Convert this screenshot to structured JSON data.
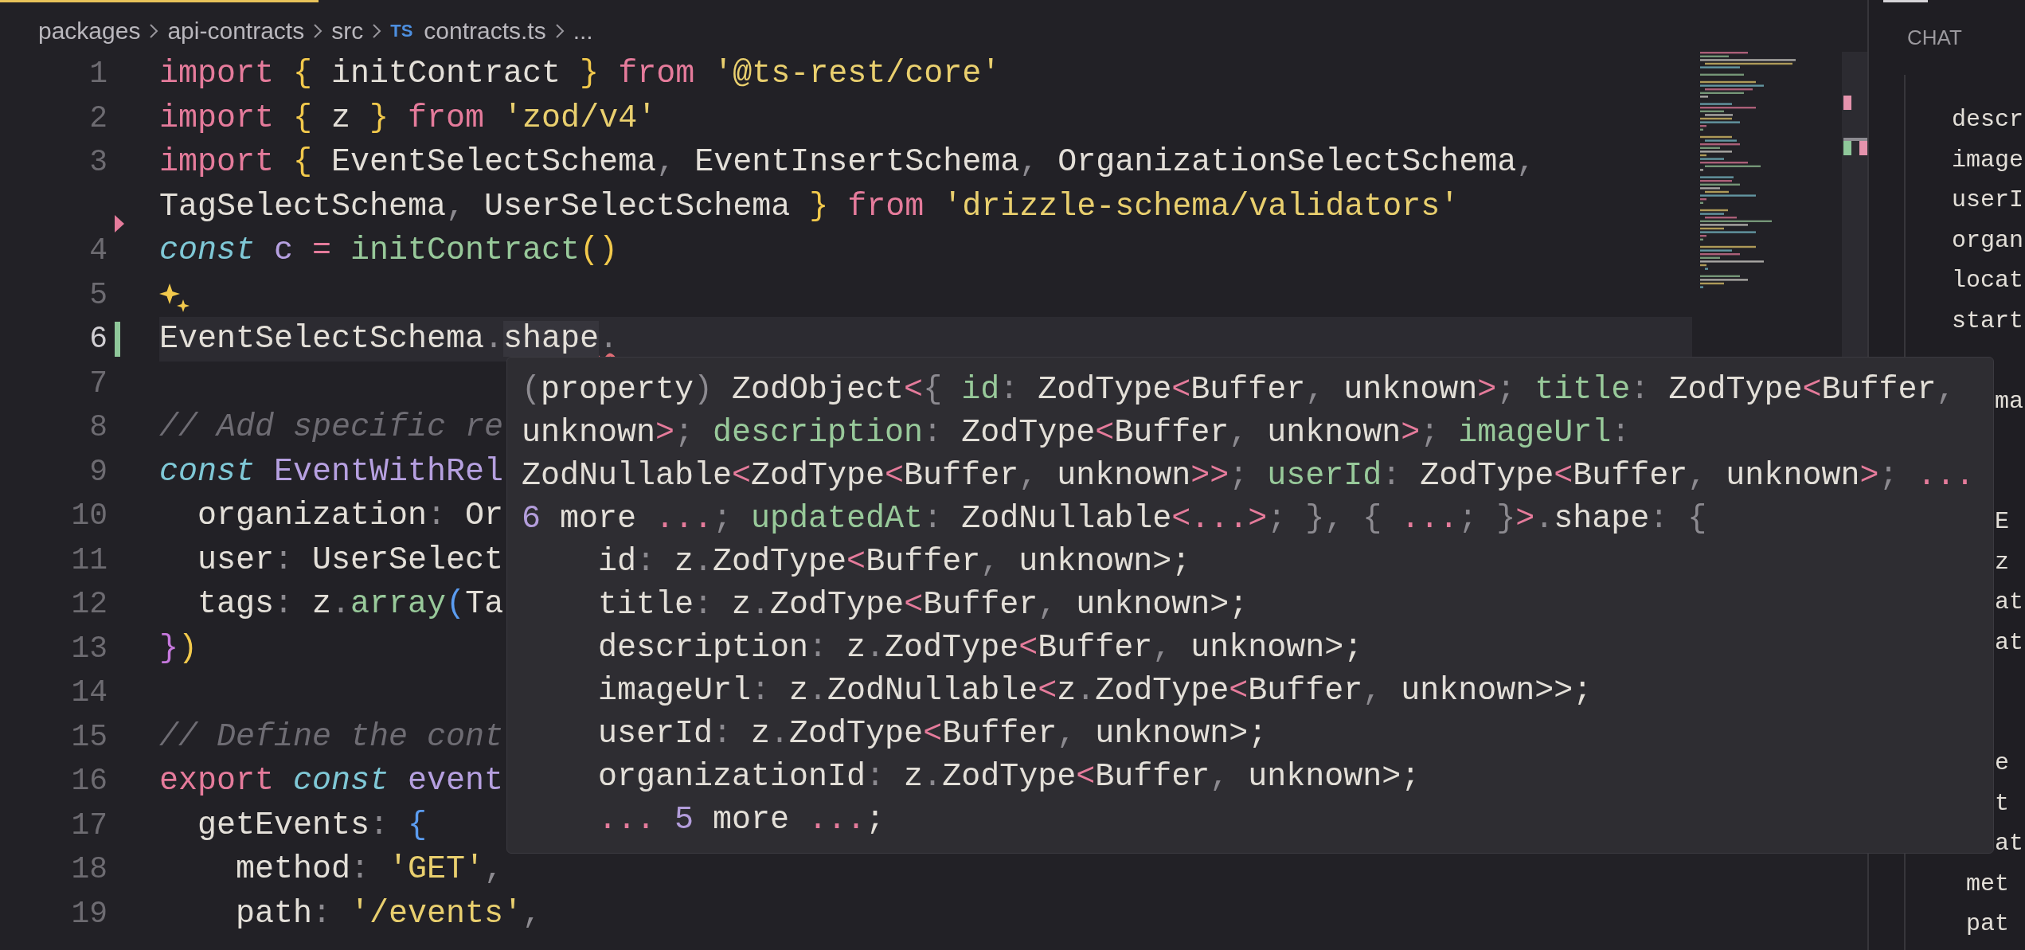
{
  "breadcrumb": [
    {
      "text": "packages"
    },
    {
      "text": "api-contracts"
    },
    {
      "text": "src"
    },
    {
      "text": "contracts.ts",
      "badge": "TS"
    },
    {
      "text": "..."
    }
  ],
  "editor": {
    "lines": [
      {
        "number": "1",
        "kind": "code",
        "current": false,
        "tokens": [
          {
            "text": "import ",
            "kind": "keyword"
          },
          {
            "text": "{",
            "kind": "bracket"
          },
          {
            "text": " initContract ",
            "kind": "plain"
          },
          {
            "text": "} ",
            "kind": "bracket"
          },
          {
            "text": "from ",
            "kind": "keyword"
          },
          {
            "text": "'@ts-rest/core'",
            "kind": "string"
          }
        ]
      },
      {
        "number": "2",
        "kind": "code",
        "current": false,
        "tokens": [
          {
            "text": "import ",
            "kind": "keyword"
          },
          {
            "text": "{",
            "kind": "bracket"
          },
          {
            "text": " z ",
            "kind": "plain"
          },
          {
            "text": "} ",
            "kind": "bracket"
          },
          {
            "text": "from ",
            "kind": "keyword"
          },
          {
            "text": "'zod/v4'",
            "kind": "string"
          }
        ]
      },
      {
        "number": "3",
        "kind": "code",
        "current": false,
        "tokens": [
          {
            "text": "import ",
            "kind": "keyword"
          },
          {
            "text": "{",
            "kind": "bracket"
          },
          {
            "text": " EventSelectSchema",
            "kind": "plain"
          },
          {
            "text": ",",
            "kind": "punct"
          },
          {
            "text": " EventInsertSchema",
            "kind": "plain"
          },
          {
            "text": ",",
            "kind": "punct"
          },
          {
            "text": " OrganizationSelectSchema",
            "kind": "plain"
          },
          {
            "text": ",",
            "kind": "punct"
          }
        ]
      },
      {
        "kind": "deleted",
        "current": false,
        "tokens": [
          {
            "text": "TagSelectSchema",
            "kind": "plain"
          },
          {
            "text": ",",
            "kind": "punct"
          },
          {
            "text": " UserSelectSchema ",
            "kind": "plain"
          },
          {
            "text": "} ",
            "kind": "bracket"
          },
          {
            "text": "from ",
            "kind": "keyword"
          },
          {
            "text": "'drizzle-schema/validators'",
            "kind": "string"
          }
        ]
      },
      {
        "number": "4",
        "kind": "code",
        "current": false,
        "tokens": [
          {
            "text": "const ",
            "kind": "storage"
          },
          {
            "text": "c ",
            "kind": "variable"
          },
          {
            "text": "= ",
            "kind": "operator"
          },
          {
            "text": "initContract",
            "kind": "function"
          },
          {
            "text": "()",
            "kind": "bracket"
          }
        ]
      },
      {
        "number": "5",
        "kind": "sparkle",
        "current": false
      },
      {
        "number": "6",
        "kind": "added",
        "current": true,
        "tokens": [
          {
            "text": "EventSelectSchema",
            "kind": "plain"
          },
          {
            "text": ".",
            "kind": "punct"
          },
          {
            "text": "shape",
            "kind": "match"
          },
          {
            "text": ".",
            "kind": "error"
          }
        ]
      },
      {
        "number": "7",
        "kind": "code",
        "current": false
      },
      {
        "number": "8",
        "kind": "code",
        "current": false,
        "tokens": [
          {
            "text": "// Add specific re",
            "kind": "comment"
          }
        ]
      },
      {
        "number": "9",
        "kind": "code",
        "current": false,
        "tokens": [
          {
            "text": "const ",
            "kind": "storage"
          },
          {
            "text": "EventWithRel",
            "kind": "variable"
          }
        ]
      },
      {
        "number": "10",
        "kind": "code",
        "current": false,
        "tokens": [
          {
            "text": "  organization",
            "kind": "plain"
          },
          {
            "text": ":",
            "kind": "punct"
          },
          {
            "text": " Or",
            "kind": "plain"
          }
        ]
      },
      {
        "number": "11",
        "kind": "code",
        "current": false,
        "tokens": [
          {
            "text": "  user",
            "kind": "plain"
          },
          {
            "text": ":",
            "kind": "punct"
          },
          {
            "text": " UserSelect",
            "kind": "plain"
          }
        ]
      },
      {
        "number": "12",
        "kind": "code",
        "current": false,
        "tokens": [
          {
            "text": "  tags",
            "kind": "plain"
          },
          {
            "text": ":",
            "kind": "punct"
          },
          {
            "text": " z",
            "kind": "plain"
          },
          {
            "text": ".",
            "kind": "punct"
          },
          {
            "text": "array",
            "kind": "function"
          },
          {
            "text": "(",
            "kind": "bracket3"
          },
          {
            "text": "Ta",
            "kind": "plain"
          }
        ]
      },
      {
        "number": "13",
        "kind": "code",
        "current": false,
        "tokens": [
          {
            "text": "}",
            "kind": "bracket2"
          },
          {
            "text": ")",
            "kind": "bracket"
          }
        ]
      },
      {
        "number": "14",
        "kind": "code",
        "current": false
      },
      {
        "number": "15",
        "kind": "code",
        "current": false,
        "tokens": [
          {
            "text": "// Define the cont",
            "kind": "comment"
          }
        ]
      },
      {
        "number": "16",
        "kind": "code",
        "current": false,
        "tokens": [
          {
            "text": "export ",
            "kind": "keyword"
          },
          {
            "text": "const ",
            "kind": "storage"
          },
          {
            "text": "event",
            "kind": "variable"
          }
        ]
      },
      {
        "number": "17",
        "kind": "code",
        "current": false,
        "tokens": [
          {
            "text": "  getEvents",
            "kind": "plain"
          },
          {
            "text": ": ",
            "kind": "punct"
          },
          {
            "text": "{",
            "kind": "bracket3"
          }
        ]
      },
      {
        "number": "18",
        "kind": "code",
        "current": false,
        "tokens": [
          {
            "text": "    method",
            "kind": "plain"
          },
          {
            "text": ": ",
            "kind": "punct"
          },
          {
            "text": "'GET'",
            "kind": "string"
          },
          {
            "text": ",",
            "kind": "punct"
          }
        ]
      },
      {
        "number": "19",
        "kind": "code",
        "current": false,
        "tokens": [
          {
            "text": "    path",
            "kind": "plain"
          },
          {
            "text": ": ",
            "kind": "punct"
          },
          {
            "text": "'/events'",
            "kind": "string"
          },
          {
            "text": ",",
            "kind": "punct"
          }
        ]
      }
    ]
  },
  "hover_tooltip": {
    "lines": [
      [
        {
          "text": "(",
          "kind": "punct"
        },
        {
          "text": "property",
          "kind": "plain"
        },
        {
          "text": ")",
          "kind": "punct"
        },
        {
          "text": " ZodObject",
          "kind": "plain"
        },
        {
          "text": "<",
          "kind": "operator"
        },
        {
          "text": "{ ",
          "kind": "punct"
        },
        {
          "text": "id",
          "kind": "property"
        },
        {
          "text": ":",
          "kind": "punct"
        },
        {
          "text": " ZodType",
          "kind": "plain"
        },
        {
          "text": "<",
          "kind": "operator"
        },
        {
          "text": "Buffer",
          "kind": "plain"
        },
        {
          "text": ",",
          "kind": "punct"
        },
        {
          "text": " unknown",
          "kind": "plain"
        },
        {
          "text": ">",
          "kind": "operator"
        },
        {
          "text": "; ",
          "kind": "punct"
        },
        {
          "text": "title",
          "kind": "property"
        },
        {
          "text": ":",
          "kind": "punct"
        },
        {
          "text": " ZodType",
          "kind": "plain"
        },
        {
          "text": "<",
          "kind": "operator"
        },
        {
          "text": "Buffer",
          "kind": "plain"
        },
        {
          "text": ",",
          "kind": "punct"
        }
      ],
      [
        {
          "text": "unknown",
          "kind": "plain"
        },
        {
          "text": ">",
          "kind": "operator"
        },
        {
          "text": "; ",
          "kind": "punct"
        },
        {
          "text": "description",
          "kind": "property"
        },
        {
          "text": ":",
          "kind": "punct"
        },
        {
          "text": " ZodType",
          "kind": "plain"
        },
        {
          "text": "<",
          "kind": "operator"
        },
        {
          "text": "Buffer",
          "kind": "plain"
        },
        {
          "text": ",",
          "kind": "punct"
        },
        {
          "text": " unknown",
          "kind": "plain"
        },
        {
          "text": ">",
          "kind": "operator"
        },
        {
          "text": "; ",
          "kind": "punct"
        },
        {
          "text": "imageUrl",
          "kind": "property"
        },
        {
          "text": ":",
          "kind": "punct"
        }
      ],
      [
        {
          "text": "ZodNullable",
          "kind": "plain"
        },
        {
          "text": "<",
          "kind": "operator"
        },
        {
          "text": "ZodType",
          "kind": "plain"
        },
        {
          "text": "<",
          "kind": "operator"
        },
        {
          "text": "Buffer",
          "kind": "plain"
        },
        {
          "text": ",",
          "kind": "punct"
        },
        {
          "text": " unknown",
          "kind": "plain"
        },
        {
          "text": ">>",
          "kind": "operator"
        },
        {
          "text": "; ",
          "kind": "punct"
        },
        {
          "text": "userId",
          "kind": "property"
        },
        {
          "text": ":",
          "kind": "punct"
        },
        {
          "text": " ZodType",
          "kind": "plain"
        },
        {
          "text": "<",
          "kind": "operator"
        },
        {
          "text": "Buffer",
          "kind": "plain"
        },
        {
          "text": ",",
          "kind": "punct"
        },
        {
          "text": " unknown",
          "kind": "plain"
        },
        {
          "text": ">",
          "kind": "operator"
        },
        {
          "text": "; ",
          "kind": "punct"
        },
        {
          "text": "...",
          "kind": "operator"
        }
      ],
      [
        {
          "text": "6",
          "kind": "number"
        },
        {
          "text": " more ",
          "kind": "plain"
        },
        {
          "text": "...",
          "kind": "operator"
        },
        {
          "text": "; ",
          "kind": "punct"
        },
        {
          "text": "updatedAt",
          "kind": "property"
        },
        {
          "text": ":",
          "kind": "punct"
        },
        {
          "text": " ZodNullable",
          "kind": "plain"
        },
        {
          "text": "<...>",
          "kind": "operator"
        },
        {
          "text": "; }, { ",
          "kind": "punct"
        },
        {
          "text": "...",
          "kind": "operator"
        },
        {
          "text": "; }",
          "kind": "punct"
        },
        {
          "text": ">",
          "kind": "operator"
        },
        {
          "text": ".",
          "kind": "punct"
        },
        {
          "text": "shape",
          "kind": "plain"
        },
        {
          "text": ":",
          "kind": "punct"
        },
        {
          "text": " {",
          "kind": "punct"
        }
      ],
      [
        {
          "text": "    id",
          "kind": "plain"
        },
        {
          "text": ":",
          "kind": "punct"
        },
        {
          "text": " z",
          "kind": "plain"
        },
        {
          "text": ".",
          "kind": "punct"
        },
        {
          "text": "ZodType",
          "kind": "plain"
        },
        {
          "text": "<",
          "kind": "operator"
        },
        {
          "text": "Buffer",
          "kind": "plain"
        },
        {
          "text": ",",
          "kind": "punct"
        },
        {
          "text": " unknown>;",
          "kind": "plain"
        }
      ],
      [
        {
          "text": "    title",
          "kind": "plain"
        },
        {
          "text": ":",
          "kind": "punct"
        },
        {
          "text": " z",
          "kind": "plain"
        },
        {
          "text": ".",
          "kind": "punct"
        },
        {
          "text": "ZodType",
          "kind": "plain"
        },
        {
          "text": "<",
          "kind": "operator"
        },
        {
          "text": "Buffer",
          "kind": "plain"
        },
        {
          "text": ",",
          "kind": "punct"
        },
        {
          "text": " unknown>;",
          "kind": "plain"
        }
      ],
      [
        {
          "text": "    description",
          "kind": "plain"
        },
        {
          "text": ":",
          "kind": "punct"
        },
        {
          "text": " z",
          "kind": "plain"
        },
        {
          "text": ".",
          "kind": "punct"
        },
        {
          "text": "ZodType",
          "kind": "plain"
        },
        {
          "text": "<",
          "kind": "operator"
        },
        {
          "text": "Buffer",
          "kind": "plain"
        },
        {
          "text": ",",
          "kind": "punct"
        },
        {
          "text": " unknown>;",
          "kind": "plain"
        }
      ],
      [
        {
          "text": "    imageUrl",
          "kind": "plain"
        },
        {
          "text": ":",
          "kind": "punct"
        },
        {
          "text": " z",
          "kind": "plain"
        },
        {
          "text": ".",
          "kind": "punct"
        },
        {
          "text": "ZodNullable",
          "kind": "plain"
        },
        {
          "text": "<",
          "kind": "operator"
        },
        {
          "text": "z",
          "kind": "plain"
        },
        {
          "text": ".",
          "kind": "punct"
        },
        {
          "text": "ZodType",
          "kind": "plain"
        },
        {
          "text": "<",
          "kind": "operator"
        },
        {
          "text": "Buffer",
          "kind": "plain"
        },
        {
          "text": ",",
          "kind": "punct"
        },
        {
          "text": " unknown>>;",
          "kind": "plain"
        }
      ],
      [
        {
          "text": "    userId",
          "kind": "plain"
        },
        {
          "text": ":",
          "kind": "punct"
        },
        {
          "text": " z",
          "kind": "plain"
        },
        {
          "text": ".",
          "kind": "punct"
        },
        {
          "text": "ZodType",
          "kind": "plain"
        },
        {
          "text": "<",
          "kind": "operator"
        },
        {
          "text": "Buffer",
          "kind": "plain"
        },
        {
          "text": ",",
          "kind": "punct"
        },
        {
          "text": " unknown>;",
          "kind": "plain"
        }
      ],
      [
        {
          "text": "    organizationId",
          "kind": "plain"
        },
        {
          "text": ":",
          "kind": "punct"
        },
        {
          "text": " z",
          "kind": "plain"
        },
        {
          "text": ".",
          "kind": "punct"
        },
        {
          "text": "ZodType",
          "kind": "plain"
        },
        {
          "text": "<",
          "kind": "operator"
        },
        {
          "text": "Buffer",
          "kind": "plain"
        },
        {
          "text": ",",
          "kind": "punct"
        },
        {
          "text": " unknown>;",
          "kind": "plain"
        }
      ],
      [
        {
          "text": "    ...",
          "kind": "operator"
        },
        {
          "text": " 5",
          "kind": "number"
        },
        {
          "text": " more ",
          "kind": "plain"
        },
        {
          "text": "...",
          "kind": "operator"
        },
        {
          "text": ";",
          "kind": "plain"
        }
      ]
    ]
  },
  "chat": {
    "title": "CHAT",
    "blocks": [
      [
        "descr",
        "image",
        "userI",
        "organ",
        "locat",
        "start"
      ],
      [
        "   ma"
      ],
      [
        "   E",
        "   z",
        "   at",
        "   at"
      ],
      [
        "   e",
        "   t",
        "   at",
        " met",
        " pat"
      ]
    ]
  }
}
